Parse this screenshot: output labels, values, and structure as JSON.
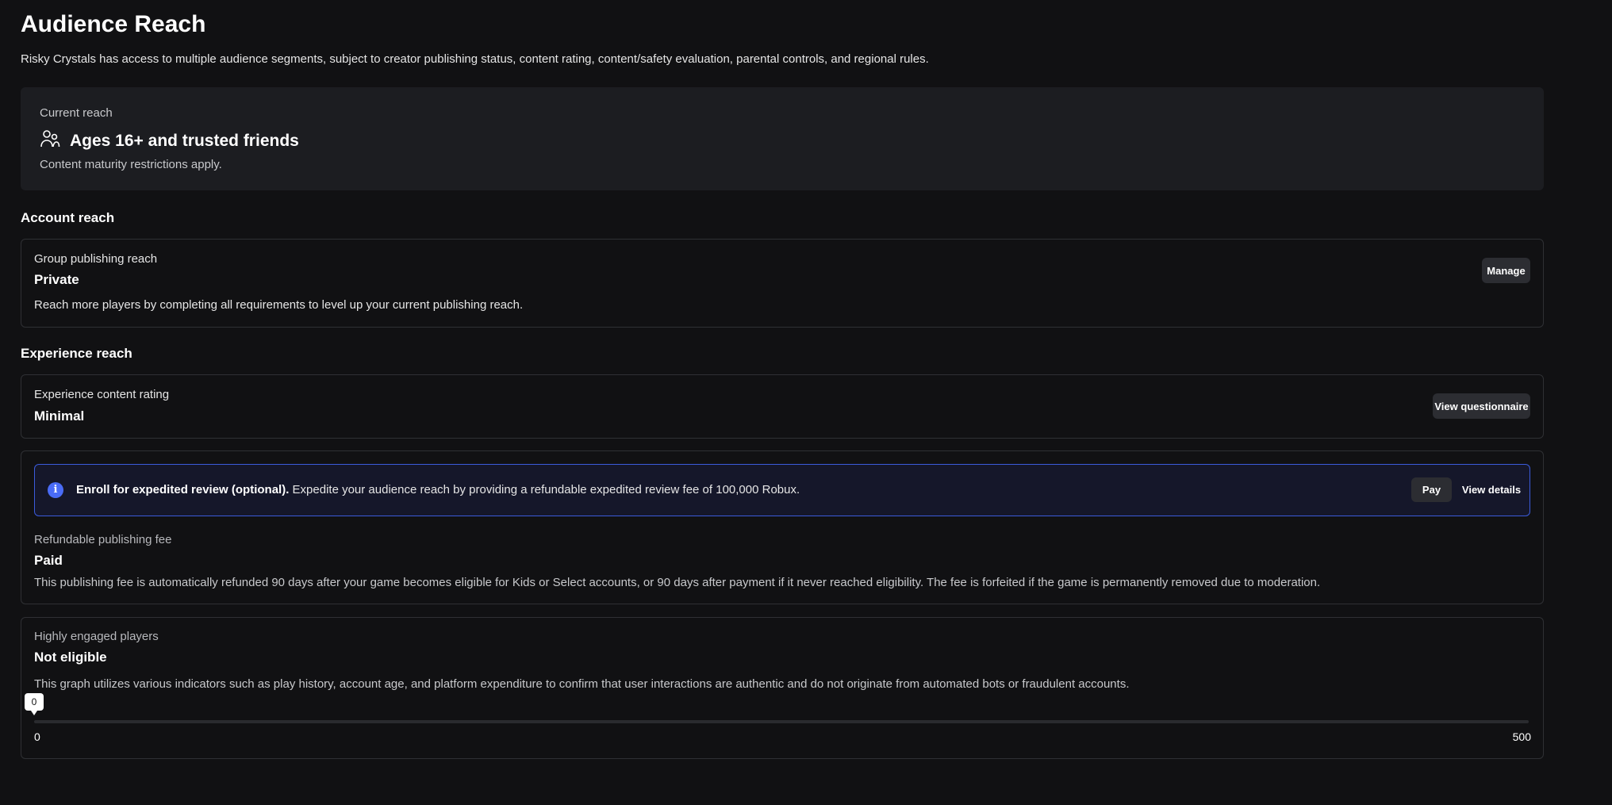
{
  "page": {
    "title": "Audience Reach",
    "description": "Risky Crystals has access to multiple audience segments, subject to creator publishing status, content rating, content/safety evaluation, parental controls, and regional rules."
  },
  "current_reach": {
    "label": "Current reach",
    "icon": "users-icon",
    "title": "Ages 16+ and trusted friends",
    "subtitle": "Content maturity restrictions apply."
  },
  "account_reach": {
    "heading": "Account reach",
    "label": "Group publishing reach",
    "value": "Private",
    "description": "Reach more players by completing all requirements to level up your current publishing reach.",
    "button": "Manage"
  },
  "experience_reach": {
    "heading": "Experience reach",
    "rating_label": "Experience content rating",
    "rating_value": "Minimal",
    "rating_button": "View questionnaire"
  },
  "expedited": {
    "icon": "info-icon",
    "bold": "Enroll for expedited review (optional).",
    "text": " Expedite your audience reach by providing a refundable expedited review fee of 100,000 Robux.",
    "pay_button": "Pay",
    "details_button": "View details"
  },
  "publishing_fee": {
    "label": "Refundable publishing fee",
    "value": "Paid",
    "description": "This publishing fee is automatically refunded 90 days after your game becomes eligible for Kids or Select accounts, or 90 days after payment if it never reached eligibility. The fee is forfeited if the game is permanently removed due to moderation."
  },
  "engaged_players": {
    "label": "Highly engaged players",
    "value": "Not eligible",
    "description": "This graph utilizes various indicators such as play history, account age, and platform expenditure to confirm that user interactions are authentic and do not originate from automated bots or fraudulent accounts.",
    "current": "0",
    "min": "0",
    "max": "500"
  },
  "colors": {
    "background": "#111113",
    "accent": "#4a6cf7"
  }
}
